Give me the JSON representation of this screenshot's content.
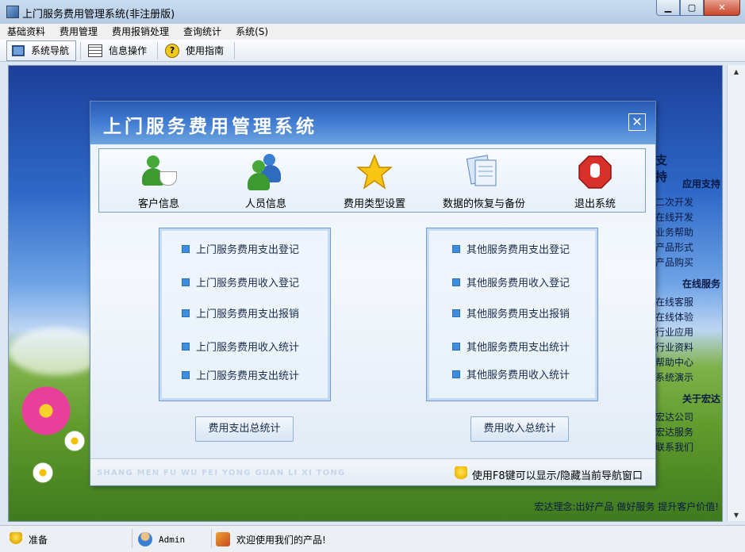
{
  "window": {
    "title": "上门服务费用管理系统(非注册版)",
    "minimize": "▁",
    "maximize": "▢",
    "close": "✕"
  },
  "menubar": [
    "基础资料",
    "费用管理",
    "费用报销处理",
    "查询统计",
    "系统(S)"
  ],
  "toolbar": {
    "items": [
      {
        "label": "系统导航",
        "icon": "monitor-icon"
      },
      {
        "label": "信息操作",
        "icon": "grid-icon"
      },
      {
        "label": "使用指南",
        "icon": "help-icon"
      }
    ]
  },
  "background": {
    "support_title": "支持",
    "sections": [
      {
        "heading": "应用支持",
        "items": [
          "二次开发",
          "在线开发",
          "业务帮助",
          "产品形式",
          "产品购买"
        ]
      },
      {
        "heading": "在线服务",
        "items": [
          "在线客服",
          "在线体验",
          "行业应用",
          "行业资料",
          "帮助中心",
          "系统演示"
        ]
      },
      {
        "heading": "关于宏达",
        "items": [
          "宏达公司",
          "宏达服务",
          "联系我们"
        ]
      }
    ],
    "motto": "宏达理念:出好产品  做好服务  提升客户价值!"
  },
  "dialog": {
    "title": "上门服务费用管理系统",
    "close": "✕",
    "icons": [
      {
        "label": "客户信息",
        "icon": "customer-coffee-icon"
      },
      {
        "label": "人员信息",
        "icon": "people-icon"
      },
      {
        "label": "费用类型设置",
        "icon": "star-icon"
      },
      {
        "label": "数据的恢复与备份",
        "icon": "documents-icon"
      },
      {
        "label": "退出系统",
        "icon": "stop-icon"
      }
    ],
    "left_panel": [
      "上门服务费用支出登记",
      "上门服务费用收入登记",
      "上门服务费用支出报销",
      "上门服务费用收入统计",
      "上门服务费用支出统计"
    ],
    "right_panel": [
      "其他服务费用支出登记",
      "其他服务费用收入登记",
      "其他服务费用支出报销",
      "其他服务费用支出统计",
      "其他服务费用收入统计"
    ],
    "buttons": {
      "expense_total": "费用支出总统计",
      "income_total": "费用收入总统计"
    },
    "pinyin": "SHANG MEN FU WU FEI YONG GUAN LI XI TONG",
    "tip": "使用F8键可以显示/隐藏当前导航窗口"
  },
  "statusbar": {
    "status": "准备",
    "user": "Admin",
    "message": "欢迎使用我们的产品!"
  }
}
